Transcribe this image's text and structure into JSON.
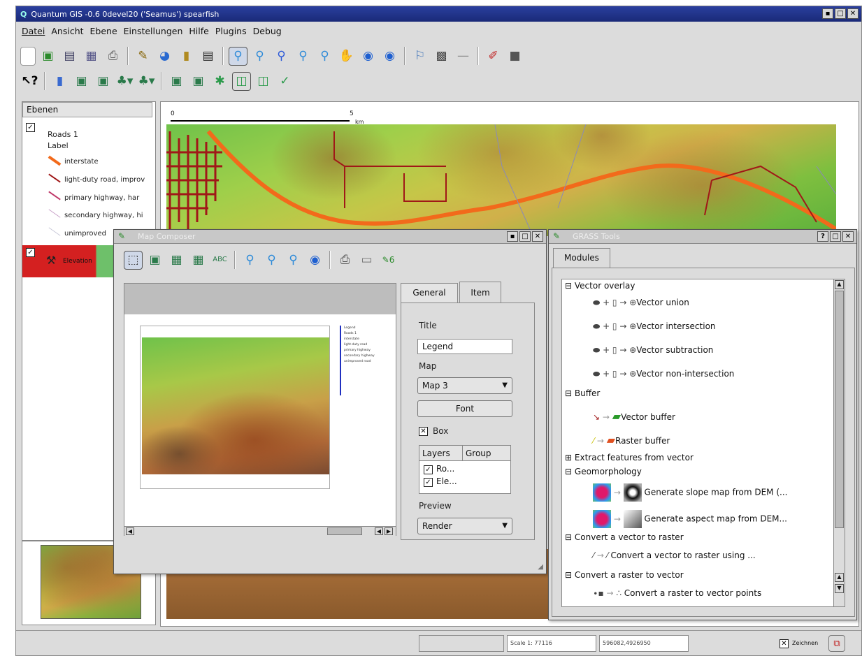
{
  "window": {
    "title": "Quantum GIS -0.6 0devel20 ('Seamus') spearfish"
  },
  "menubar": [
    "Datei",
    "Ansicht",
    "Ebene",
    "Einstellungen",
    "Hilfe",
    "Plugins",
    "Debug"
  ],
  "icons": {
    "toolbar1": [
      "new-project-icon",
      "open-project-icon",
      "save-project-icon",
      "save-as-icon",
      "print-icon",
      "add-vector-layer-icon",
      "add-raster-layer-icon",
      "add-postgis-icon",
      "table-icon",
      "zoom-in-icon",
      "zoom-out-icon",
      "zoom-full-icon",
      "zoom-select-icon",
      "zoom-layer-icon",
      "pan-icon",
      "zoom-previous-icon",
      "refresh-icon",
      "identify-icon",
      "select-features-icon",
      "measure-line-icon",
      "capture-icon",
      "map-composer-icon"
    ],
    "toolbar2": [
      "whats-this-icon",
      "grass-mapset-icon",
      "grass-open-vector-icon",
      "grass-open-raster-icon",
      "grass-region-icon",
      "grass-edit-icon",
      "grass-new-vector-icon",
      "grass-raster-icon",
      "grass-tools-icon",
      "grass-display-region-icon",
      "grass-edit-region-icon",
      "grass-digitize-icon"
    ]
  },
  "layers_panel": {
    "header": "Ebenen",
    "layer1": {
      "name": "Roads 1",
      "sub": "Label",
      "checked": true
    },
    "legend": [
      "interstate",
      "light-duty road, improv",
      "primary highway, har",
      "secondary highway, hi",
      "unimproved"
    ],
    "layer2": {
      "name": "Elevation",
      "checked": true
    }
  },
  "map": {
    "scale_start": "0",
    "scale_end": "5",
    "scale_unit": "km"
  },
  "statusbar": {
    "scale": "Scale 1: 77116",
    "coords": "596082,4926950",
    "render_label": "Zeichnen",
    "render_checked": true
  },
  "composer": {
    "title": "Map Composer",
    "tabs": [
      "General",
      "Item"
    ],
    "active_tab": "Item",
    "title_label": "Title",
    "title_value": "Legend",
    "map_label": "Map",
    "map_value": "Map 3",
    "font_button": "Font",
    "box_label": "Box",
    "box_checked": true,
    "columns": [
      "Layers",
      "Group"
    ],
    "rows": [
      "Ro...",
      "Ele..."
    ],
    "preview_label": "Preview",
    "preview_value": "Render",
    "legend_preview": [
      "Legend",
      "Roads 1",
      "interstate",
      "light-duty road",
      "primary highway",
      "secondary highway",
      "unimproved road"
    ]
  },
  "grass": {
    "title": "GRASS Tools",
    "tab": "Modules",
    "groups": [
      {
        "label": "Vector overlay",
        "items": [
          "Vector union",
          "Vector intersection",
          "Vector subtraction",
          "Vector non-intersection"
        ]
      },
      {
        "label": "Buffer",
        "items": [
          "Vector buffer",
          "Raster buffer"
        ]
      },
      {
        "label": "Extract features from vector",
        "items": []
      },
      {
        "label": "Geomorphology",
        "items": [
          "Generate slope map from DEM (...",
          "Generate aspect map from DEM..."
        ]
      },
      {
        "label": "Convert a vector to raster",
        "items": [
          "Convert a vector to raster using ..."
        ]
      },
      {
        "label": "Convert a raster to vector",
        "items": [
          "Convert a raster to vector points"
        ]
      }
    ]
  },
  "colors": {
    "titlebar": "#1f2f86",
    "interstate": "#f26a1b",
    "roads": "#a01818"
  }
}
